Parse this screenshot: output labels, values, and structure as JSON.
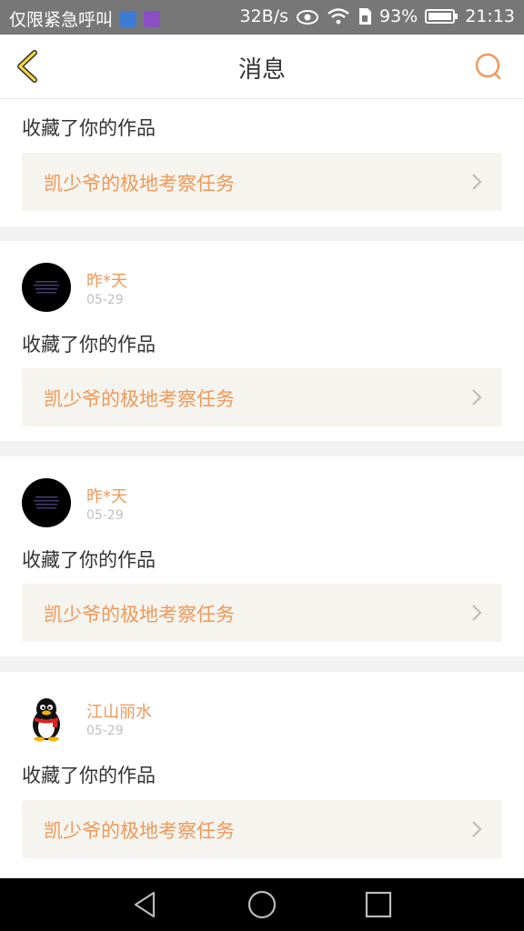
{
  "status_bar": {
    "carrier": "仅限紧急呼叫",
    "speed": "32B/s",
    "battery": "93%",
    "time": "21:13",
    "icons": [
      "notification-app-icon",
      "notification-app-icon-2",
      "eye-icon",
      "wifi-icon",
      "sim-icon",
      "battery-icon"
    ]
  },
  "header": {
    "title": "消息",
    "back_icon": "back-chevron-icon",
    "search_icon": "search-icon"
  },
  "colors": {
    "accent": "#f0995a",
    "card_bg": "#ffffff",
    "work_bg": "#f5f4ee",
    "page_bg": "#f2f2f2"
  },
  "notifications": [
    {
      "user": "",
      "date": "",
      "action": "收藏了你的作品",
      "work_title": "凯少爷的极地考察任务"
    },
    {
      "user": "昨*天",
      "date": "05-29",
      "action": "收藏了你的作品",
      "work_title": "凯少爷的极地考察任务"
    },
    {
      "user": "昨*天",
      "date": "05-29",
      "action": "收藏了你的作品",
      "work_title": "凯少爷的极地考察任务"
    },
    {
      "user": "江山丽水",
      "date": "05-29",
      "action": "收藏了你的作品",
      "work_title": "凯少爷的极地考察任务"
    }
  ],
  "nav_bar": {
    "icons": [
      "back-triangle-icon",
      "home-circle-icon",
      "recents-square-icon"
    ]
  }
}
